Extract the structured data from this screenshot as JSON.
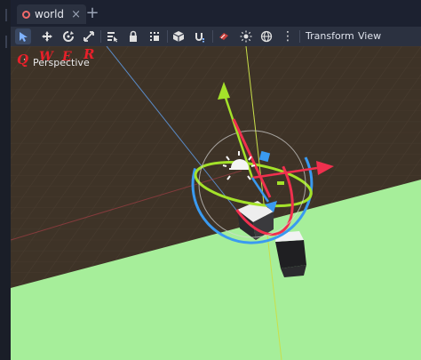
{
  "tabs": {
    "scene_tab_label": "world",
    "add_tab_glyph": "+"
  },
  "toolbar": {
    "tools": [
      {
        "name": "select-mode",
        "icon": "cursor-arrow-icon",
        "active": true
      },
      {
        "name": "move-mode",
        "icon": "move-arrows-icon",
        "active": false
      },
      {
        "name": "rotate-mode",
        "icon": "rotate-icon",
        "active": false
      },
      {
        "name": "scale-mode",
        "icon": "scale-icon",
        "active": false
      },
      {
        "name": "list-select",
        "icon": "list-select-icon",
        "active": false
      },
      {
        "name": "lock",
        "icon": "lock-icon",
        "active": false
      },
      {
        "name": "group",
        "icon": "group-icon",
        "active": false
      },
      {
        "name": "local-space",
        "icon": "local-space-icon",
        "active": false
      },
      {
        "name": "snap",
        "icon": "snap-icon",
        "active": false
      },
      {
        "name": "preview-sun",
        "icon": "sun-icon",
        "active": false
      },
      {
        "name": "preview-environment",
        "icon": "globe-icon",
        "active": false
      }
    ],
    "more_glyph": "⋮",
    "transform_label": "Transform",
    "view_label": "View"
  },
  "annotations": {
    "shortcut_letters": [
      "Q",
      "W",
      "E",
      "R"
    ],
    "color": "#e8202a"
  },
  "viewport": {
    "perspective_label": "Perspective"
  },
  "colors": {
    "ground_plane": "#a6ee9a",
    "floor_grid": "#3f3328",
    "axis_x": "#f0304e",
    "axis_y": "#a4e22a",
    "axis_z": "#3a9af0",
    "accent": "#4d7ed8"
  }
}
